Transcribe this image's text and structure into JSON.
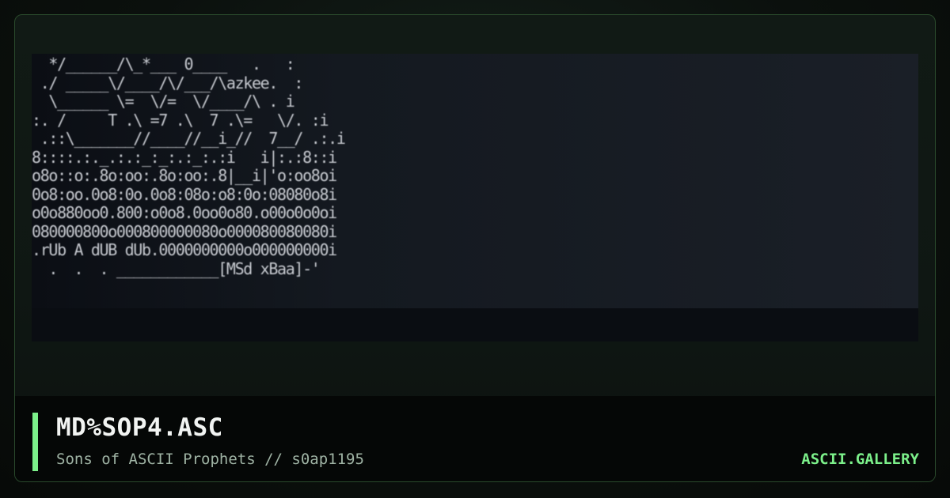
{
  "artwork": {
    "filename": "MD%SOP4.ASC",
    "credit": "Sons of ASCII Prophets // s0ap1195",
    "ascii_lines": [
      "  */______/\\_*___ 0____   .   :",
      " ./ _____\\/____/\\/___/\\azkee.  :",
      "  \\______ \\=  \\/=  \\/____/\\ . i",
      ":. /     T .\\ =7 .\\  7 .\\=   \\/. :i",
      " .::\\_______//____//__i_//  7__/ .:.i",
      "8::::.:._.:.:_:_:.:_:.:i   i|:.:8::i",
      "o8o::o:.8o:oo:.8o:oo:.8|__i|'o:oo8oi",
      "0o8:oo.0o8:0o.0o8:08o:o8:0o:08080o8i",
      "o0o880oo0.800:o0o8.0oo0o80.o00o0o0oi",
      "080000800o000800000080o000080080080i",
      ".rUb A dUB dUb.0000000000o000000000i",
      "  .  .  . ____________[MSd xBaa]-'"
    ]
  },
  "branding": {
    "site": "ASCII.GALLERY"
  },
  "colors": {
    "accent": "#7cf08a",
    "border": "#2a4a2c",
    "footer_bg": "#050706"
  }
}
